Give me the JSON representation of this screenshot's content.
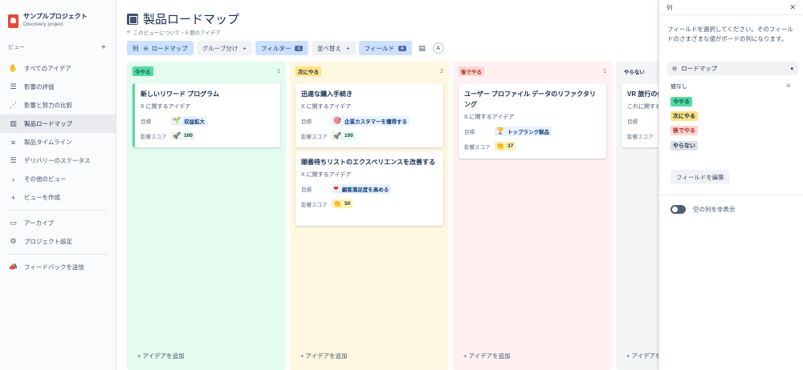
{
  "project": {
    "name": "サンプルプロジェクト",
    "subtitle": "Discovery project"
  },
  "sidebar": {
    "section_label": "ビュー",
    "items": [
      {
        "label": "すべてのアイデア",
        "icon": "hand-icon"
      },
      {
        "label": "影響の評価",
        "icon": "list-icon"
      },
      {
        "label": "影響と努力の比較",
        "icon": "scatter-icon"
      },
      {
        "label": "製品ロードマップ",
        "icon": "board-icon"
      },
      {
        "label": "製品タイムライン",
        "icon": "timeline-icon"
      },
      {
        "label": "デリバリーのステータス",
        "icon": "list-icon"
      },
      {
        "label": "その他のビュー",
        "icon": "chevron-right-icon"
      }
    ],
    "create_view": "ビューを作成",
    "archive": "アーカイブ",
    "project_settings": "プロジェクト設定",
    "feedback": "フィードバックを送信"
  },
  "header": {
    "title": "製品ロードマップ",
    "subline": "このビューについて・5 個のアイデア"
  },
  "toolbar": {
    "column_label": "列",
    "column_value": "ロードマップ",
    "group": "グループ分け",
    "filter": "フィルター",
    "filter_count": "1",
    "sort": "並べ替え",
    "fields": "フィールド",
    "fields_count": "4"
  },
  "columns": [
    {
      "label": "今やる",
      "count": "1",
      "bg": "#e3fcef",
      "pill_bg": "#57d9a3",
      "pill_fg": "#064",
      "add": "アイデアを追加",
      "cards": [
        {
          "title": "新しいリワード プログラム",
          "sub": "X に関するアイデア",
          "goal_label": "目標",
          "goal": "収益拡大",
          "goal_icon": "🌱",
          "score_label": "影響スコア",
          "score": "100",
          "score_icon": "🚀",
          "score_bg": "#e3fcef"
        }
      ]
    },
    {
      "label": "次にやる",
      "count": "2",
      "bg": "#fff7e0",
      "pill_bg": "#ffe380",
      "pill_fg": "#172b4d",
      "add": "アイデアを追加",
      "cards": [
        {
          "title": "迅速な購入手続き",
          "sub": "X に関するアイデア",
          "goal_label": "目標",
          "goal": "企業カスタマーを獲得する",
          "goal_icon": "🎯",
          "score_label": "影響スコア",
          "score": "100",
          "score_icon": "🚀",
          "score_bg": "#e3fcef"
        },
        {
          "title": "順番待ちリストのエクスペリエンスを改善する",
          "sub": "X に関するアイデア",
          "goal_label": "目標",
          "goal": "顧客満足度を高める",
          "goal_icon": "❤",
          "score_label": "影響スコア",
          "score": "50",
          "score_icon": "👏",
          "score_bg": "#fff0b3"
        }
      ]
    },
    {
      "label": "後でやる",
      "count": "1",
      "bg": "#fff1f1",
      "pill_bg": "#ffd5d2",
      "pill_fg": "#ae2e24",
      "add": "アイデアを追加",
      "cards": [
        {
          "title": "ユーザー プロファイル データのリファクタリング",
          "sub": "X に関するアイデア",
          "goal_label": "目標",
          "goal": "トップランク製品",
          "goal_icon": "🏆",
          "score_label": "影響スコア",
          "score": "37",
          "score_icon": "👏",
          "score_bg": "#fff0b3"
        }
      ]
    },
    {
      "label": "やらない",
      "count": "",
      "bg": "#f4f5f7",
      "pill_bg": "#dfe1e6",
      "pill_fg": "#172b4d",
      "add": "アイデアを追加",
      "cards": [
        {
          "title": "VR 旅行の体",
          "sub": "これに関する",
          "goal_label": "目標",
          "goal": "",
          "goal_icon": "",
          "score_label": "影響スコア",
          "score": "",
          "score_icon": "",
          "score_bg": "#fff"
        }
      ]
    }
  ],
  "panel": {
    "title": "列",
    "description": "フィールドを選択してください。そのフィールドのさまざまな値がボードの列になります。",
    "select_value": "ロードマップ",
    "options": [
      {
        "label": "値なし",
        "bg": "transparent",
        "fg": "#172b4d"
      },
      {
        "label": "今やる",
        "bg": "#57d9a3",
        "fg": "#064"
      },
      {
        "label": "次にやる",
        "bg": "#ffe380",
        "fg": "#172b4d"
      },
      {
        "label": "後でやる",
        "bg": "#ffd5d2",
        "fg": "#ae2e24"
      },
      {
        "label": "やらない",
        "bg": "#dfe1e6",
        "fg": "#172b4d"
      }
    ],
    "edit_fields": "フィールドを編集",
    "hide_empty": "空の列を非表示"
  }
}
